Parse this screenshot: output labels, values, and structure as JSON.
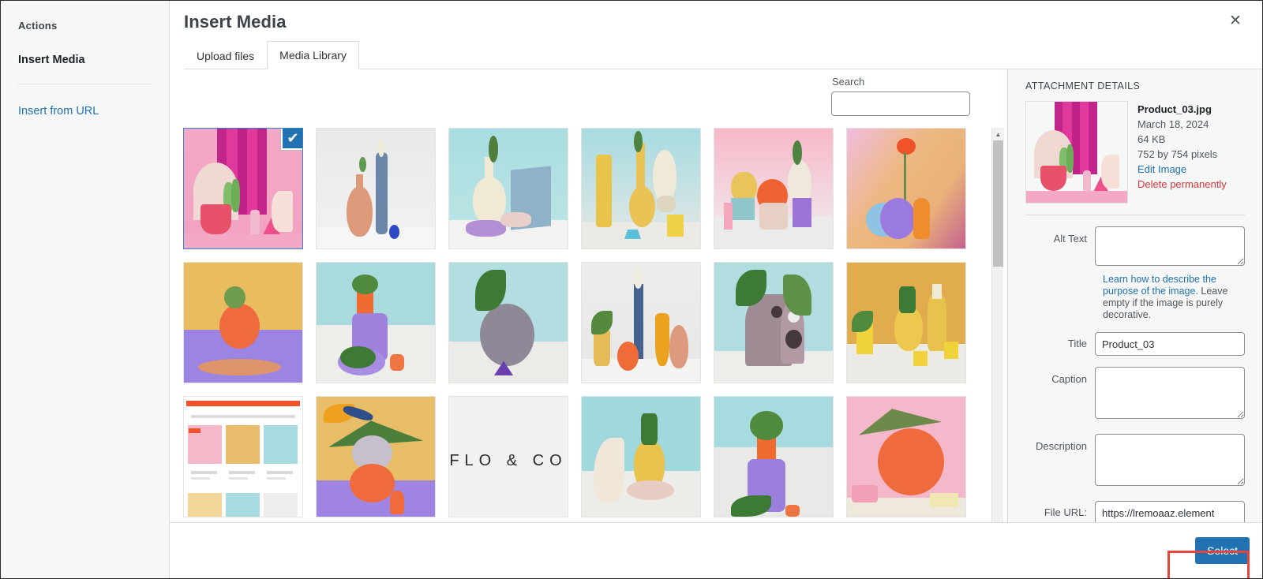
{
  "window": {
    "close_icon": "close-icon",
    "close_label": "✕"
  },
  "sidebar": {
    "heading": "Actions",
    "active_item": "Insert Media",
    "link": "Insert from URL"
  },
  "header": {
    "title": "Insert Media"
  },
  "tabs": [
    {
      "label": "Upload files",
      "active": false
    },
    {
      "label": "Media Library",
      "active": true
    }
  ],
  "search": {
    "label": "Search",
    "value": "",
    "placeholder": ""
  },
  "grid": {
    "scrollbar": {
      "up_arrow": "▲",
      "down_arrow": "▼"
    },
    "selected_index": 0,
    "check_glyph": "✔",
    "items": [
      {
        "name": "Product_03.jpg",
        "selected": true,
        "bg": "linear-gradient(180deg,#f4a8c6 0%,#f2a2c2 100%)"
      },
      {
        "name": "thumbnail-2",
        "selected": false,
        "bg": "linear-gradient(180deg,#e9e9ea 0%,#f2f2f2 100%)"
      },
      {
        "name": "thumbnail-3",
        "selected": false,
        "bg": "linear-gradient(180deg,#a8dde0 0%,#bfe5e6 100%)"
      },
      {
        "name": "thumbnail-4",
        "selected": false,
        "bg": "linear-gradient(180deg,#a6dbe0 0%,#e8e8e6 100%)"
      },
      {
        "name": "thumbnail-5",
        "selected": false,
        "bg": "linear-gradient(180deg,#f7b8c8 0%,#efeff0 100%)"
      },
      {
        "name": "thumbnail-6",
        "selected": false,
        "bg": "linear-gradient(140deg,#f3b7cf 0%,#edb57f 55%,#c9719b 100%)"
      },
      {
        "name": "thumbnail-7",
        "selected": false,
        "bg": "linear-gradient(180deg,#e9bd6c 0%,#a489e8 100%)"
      },
      {
        "name": "thumbnail-8",
        "selected": false,
        "bg": "linear-gradient(180deg,#b6dfe2 0%,#ececed 100%)"
      },
      {
        "name": "thumbnail-9",
        "selected": false,
        "bg": "linear-gradient(180deg,#b8e0e2 0%,#ececea 100%)"
      },
      {
        "name": "thumbnail-10",
        "selected": false,
        "bg": "linear-gradient(180deg,#ededee 0%,#e6e6e4 100%)"
      },
      {
        "name": "thumbnail-11",
        "selected": false,
        "bg": "linear-gradient(180deg,#b5dee2 0%,#eaeae8 100%)"
      },
      {
        "name": "thumbnail-12",
        "selected": false,
        "bg": "linear-gradient(180deg,#e0ac4e 0%,#e9e9e7 100%)"
      },
      {
        "name": "thumbnail-13",
        "selected": false,
        "bg": "#ffffff"
      },
      {
        "name": "thumbnail-14",
        "selected": false,
        "bg": "linear-gradient(180deg,#e7bd6b 0%,#a188e6 100%)"
      },
      {
        "name": "thumbnail-15",
        "selected": false,
        "bg": "linear-gradient(180deg,#f2f2f2 0%,#ededed 100%)"
      },
      {
        "name": "thumbnail-16",
        "selected": false,
        "bg": "linear-gradient(180deg,#9fd8dd 0%,#ededeb 100%)"
      },
      {
        "name": "thumbnail-17",
        "selected": false,
        "bg": "linear-gradient(180deg,#a7dce0 0%,#a98fe6 100%)"
      },
      {
        "name": "thumbnail-18",
        "selected": false,
        "bg": "linear-gradient(180deg,#f6b9cd 0%,#f0ece5 100%)"
      }
    ],
    "item_13_text": "FLO & CO"
  },
  "details": {
    "panel_title": "ATTACHMENT DETAILS",
    "filename": "Product_03.jpg",
    "date": "March 18, 2024",
    "filesize": "64 KB",
    "dimensions": "752 by 754 pixels",
    "edit_link": "Edit Image",
    "delete_link": "Delete permanently",
    "fields": {
      "alt_text_label": "Alt Text",
      "alt_text_value": "",
      "help_link_text": "Learn how to describe the purpose of the image",
      "help_rest_text": ". Leave empty if the image is purely decorative.",
      "title_label": "Title",
      "title_value": "Product_03",
      "caption_label": "Caption",
      "caption_value": "",
      "description_label": "Description",
      "description_value": "",
      "file_url_label": "File URL:",
      "file_url_value": "https://lremoaaz.element"
    }
  },
  "footer": {
    "select_label": "Select"
  },
  "colors": {
    "accent": "#2271b1",
    "selection_outline": "#3582c4",
    "danger": "#d63638",
    "highlight": "#e8433d",
    "sidebar_bg": "#f6f7f7"
  }
}
